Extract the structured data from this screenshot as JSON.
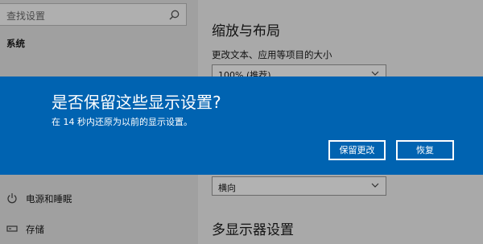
{
  "sidebar": {
    "search_placeholder": "查找设置",
    "section": "系统",
    "items": [
      {
        "label": "电源和睡眠",
        "icon": "power-icon"
      },
      {
        "label": "存储",
        "icon": "storage-icon"
      }
    ]
  },
  "main": {
    "title": "缩放与布局",
    "scale_label": "更改文本、应用等项目的大小",
    "scale_value": "100% (推荐)",
    "orientation_value": "横向",
    "multi_display_title": "多显示器设置"
  },
  "dialog": {
    "title": "是否保留这些显示设置?",
    "message": "在 14 秒内还原为以前的显示设置。",
    "keep_label": "保留更改",
    "revert_label": "恢复"
  },
  "colors": {
    "accent": "#0063b1",
    "sidebar_bg": "#e6e6e6",
    "main_bg": "#f2f2f2"
  }
}
